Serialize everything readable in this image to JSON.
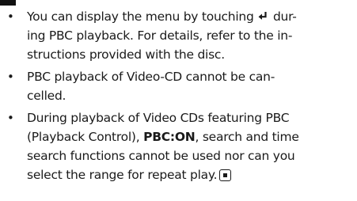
{
  "notes": {
    "bullet": "•",
    "item1": {
      "line1_before_icon": "You can display the menu by touching ",
      "return_icon": "return-arrow-icon",
      "line1_after_icon": " dur-",
      "line2": "ing PBC playback. For details, refer to the in-",
      "line3": "structions provided with the disc."
    },
    "item2": {
      "line1": "PBC playback of Video-CD cannot be can-",
      "line2": "celled."
    },
    "item3": {
      "line1": "During playback of Video CDs featuring PBC",
      "line2_before_bold": "(Playback Control), ",
      "line2_bold": "PBC:ON",
      "line2_after_bold": ", search and time",
      "line3": "search functions cannot be used nor can you",
      "line4": "select the range for repeat play.",
      "end_icon": "end-of-section-icon"
    }
  }
}
